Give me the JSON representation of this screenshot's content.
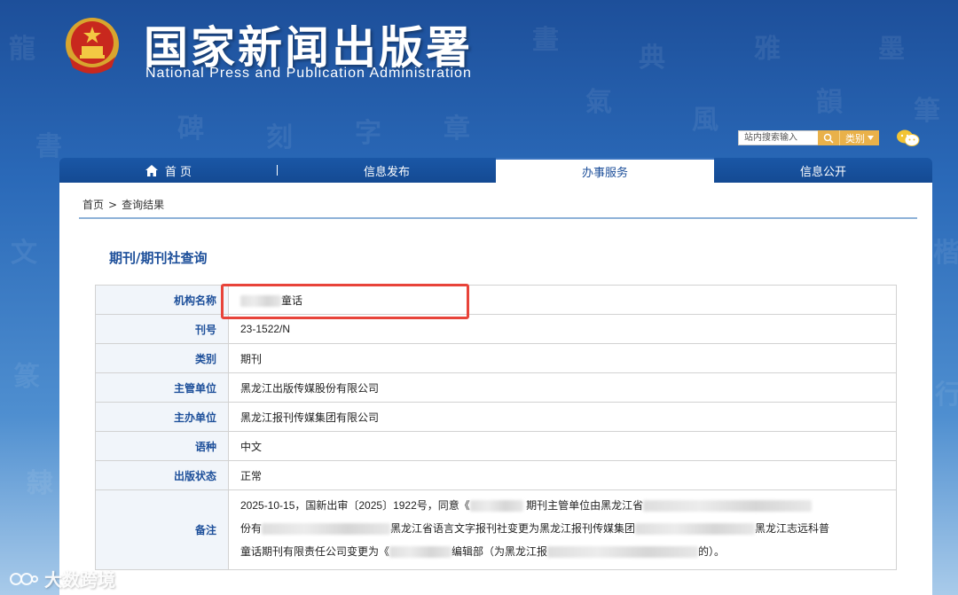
{
  "header": {
    "title": "国家新闻出版署",
    "subtitle": "National Press and Publication Administration",
    "search_placeholder": "站内搜索输入",
    "category_label": "类别"
  },
  "nav": {
    "items": [
      {
        "label": "首 页"
      },
      {
        "label": "信息发布"
      },
      {
        "label": "办事服务"
      },
      {
        "label": "信息公开"
      }
    ],
    "active_index": 2
  },
  "breadcrumb": {
    "home": "首页",
    "separator": ">",
    "current": "查询结果"
  },
  "page_heading": "期刊/期刊社查询",
  "details": {
    "rows": [
      {
        "key": "机构名称",
        "value": "童话"
      },
      {
        "key": "刊号",
        "value": "23-1522/N"
      },
      {
        "key": "类别",
        "value": "期刊"
      },
      {
        "key": "主管单位",
        "value": "黑龙江出版传媒股份有限公司"
      },
      {
        "key": "主办单位",
        "value": "黑龙江报刊传媒集团有限公司"
      },
      {
        "key": "语种",
        "value": "中文"
      },
      {
        "key": "出版状态",
        "value": "正常"
      }
    ],
    "note_key": "备注",
    "note": {
      "p1": "2025-10-15，国新出审〔2025〕1922号，同意《",
      "p2": "期刊主管单位由黑龙江省",
      "p3": "份有",
      "p4": "黑龙江省语言文字报刊社变更为黑龙江报刊传媒集团",
      "p5": "黑龙江志远科普",
      "p6": "童话期刊有限责任公司变更为《",
      "p7": "编辑部（为黑龙江报",
      "p8": "的）。"
    }
  },
  "watermark": "大数跨境",
  "colors": {
    "brand_blue": "#1d4f9a",
    "highlight_red": "#e8443a",
    "search_orange": "#e9b14a"
  }
}
